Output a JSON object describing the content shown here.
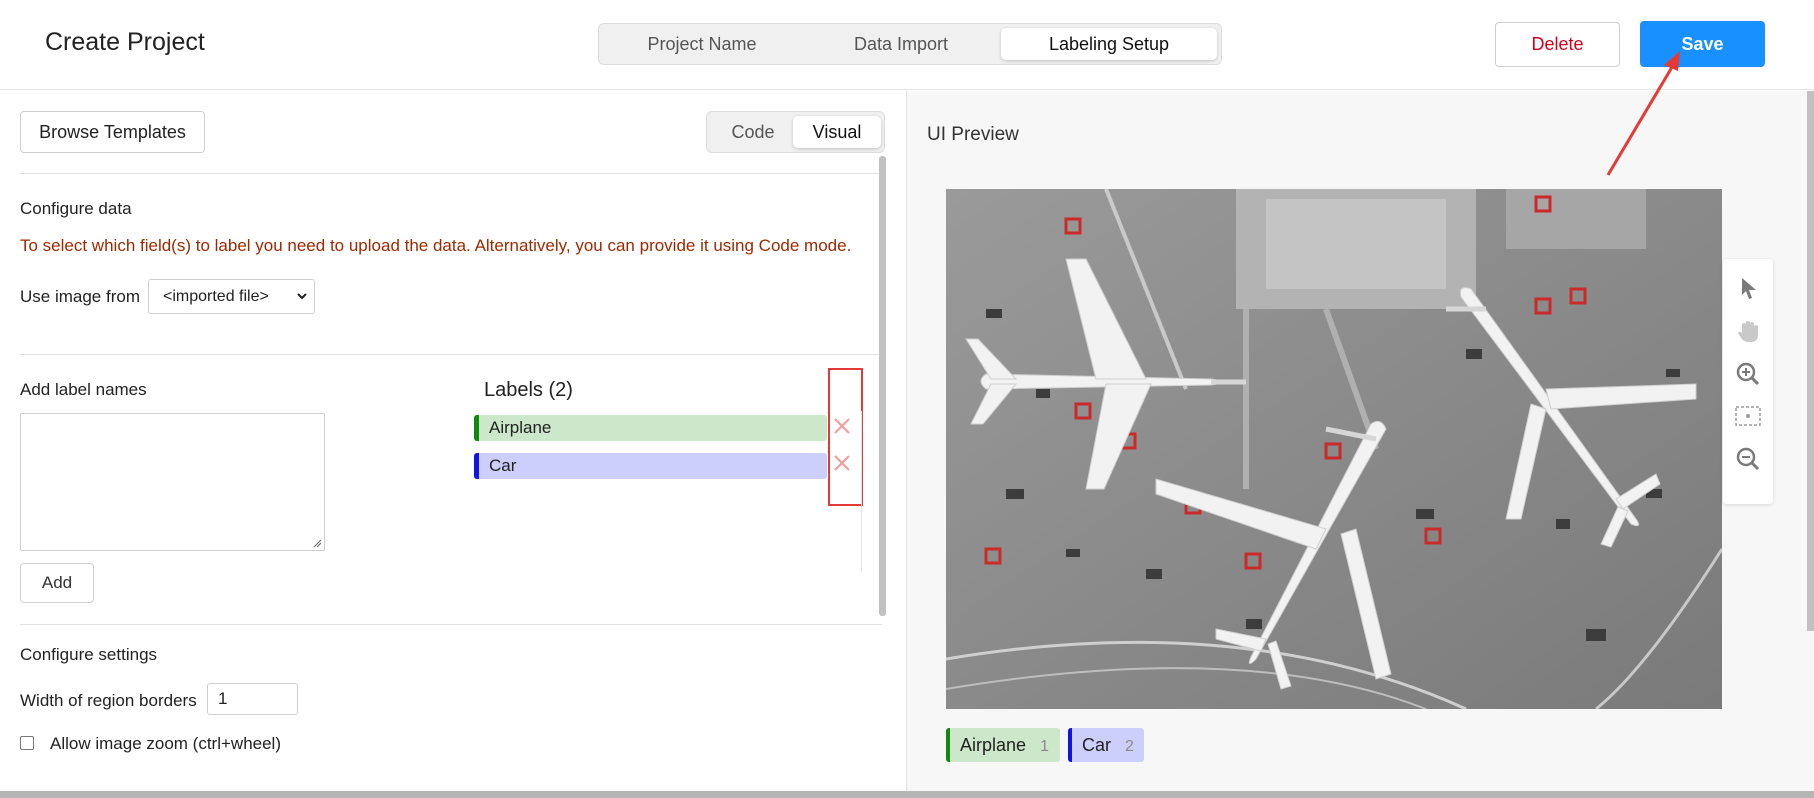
{
  "header": {
    "title": "Create Project",
    "steps": [
      "Project Name",
      "Data Import",
      "Labeling Setup"
    ],
    "active_step": "Labeling Setup",
    "delete_label": "Delete",
    "save_label": "Save"
  },
  "left": {
    "browse_label": "Browse Templates",
    "modes": [
      "Code",
      "Visual"
    ],
    "active_mode": "Visual",
    "configure_data": {
      "title": "Configure data",
      "warning": "To select which field(s) to label you need to upload the data. Alternatively, you can provide it using Code mode.",
      "use_image_label": "Use image from",
      "use_image_value": "<imported file>"
    },
    "labels": {
      "add_title": "Add label names",
      "add_button": "Add",
      "list_title": "Labels (2)",
      "items": [
        {
          "name": "Airplane",
          "color": "#0f8a0f",
          "bg": "#cde7cb"
        },
        {
          "name": "Car",
          "color": "#1014e6",
          "bg": "#cccffb"
        }
      ]
    },
    "settings": {
      "title": "Configure settings",
      "width_label": "Width of region borders",
      "width_value": "1",
      "zoom_label": "Allow image zoom (ctrl+wheel)"
    }
  },
  "right": {
    "preview_title": "UI Preview",
    "chips": [
      {
        "name": "Airplane",
        "count": "1"
      },
      {
        "name": "Car",
        "count": "2"
      }
    ],
    "tools": [
      "pointer-icon",
      "hand-icon",
      "zoom-in-icon",
      "fit-screen-icon",
      "zoom-out-icon"
    ]
  },
  "colors": {
    "accent": "#1890ff",
    "delete": "#d0021b",
    "warning": "#9c2a00",
    "annotation": "#e53935"
  }
}
